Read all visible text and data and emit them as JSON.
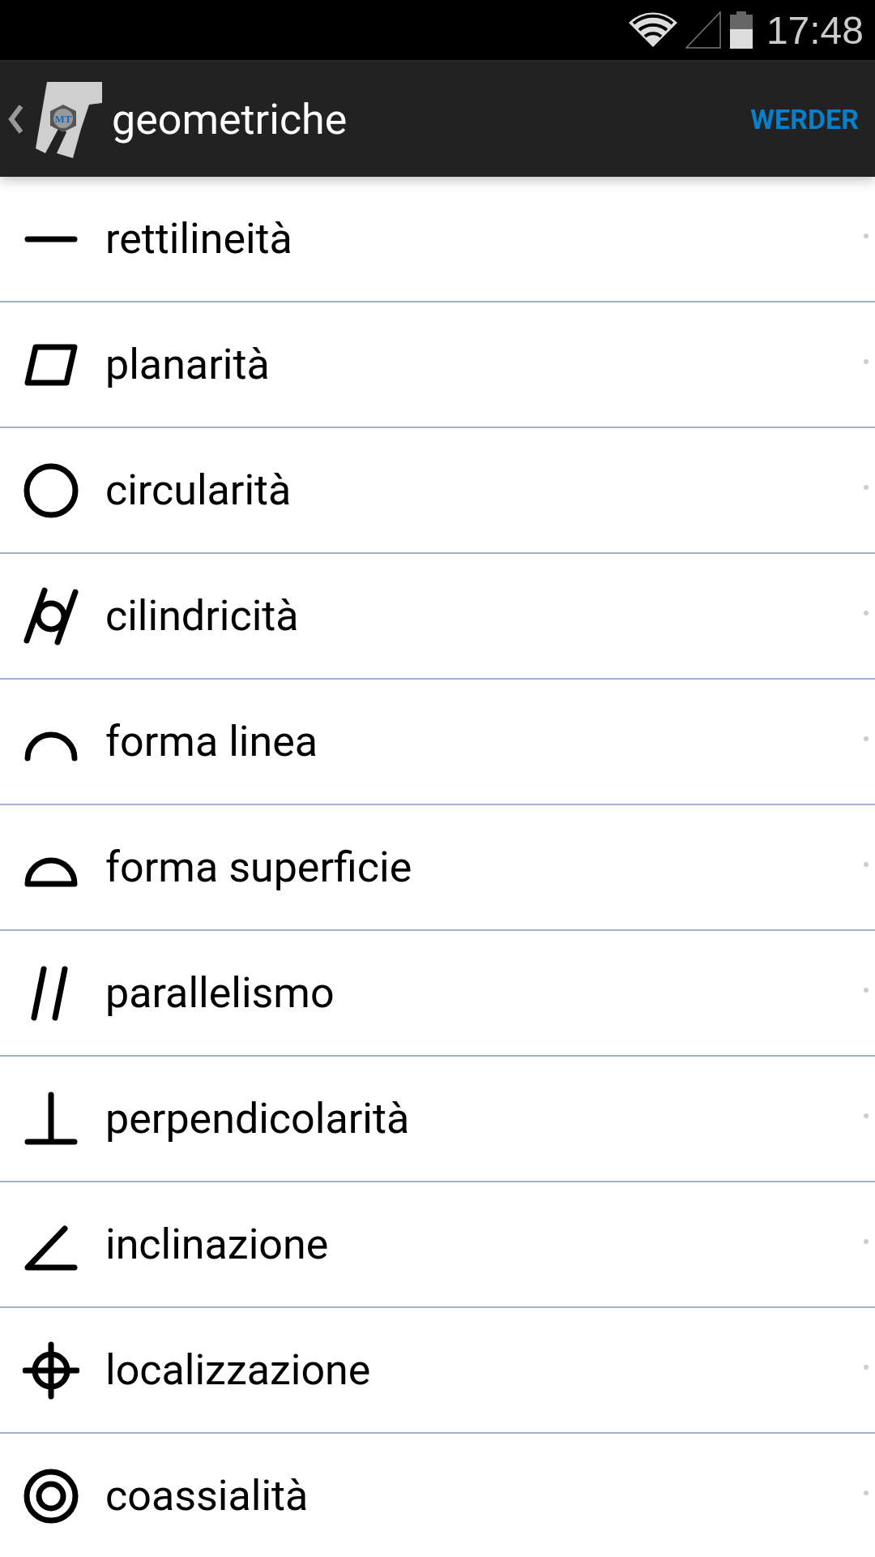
{
  "status_bar": {
    "time": "17:48"
  },
  "app_bar": {
    "logo_text": "MT",
    "title": "geometriche",
    "action": "WERDER"
  },
  "rows": [
    {
      "kind": "straightness",
      "label": "rettilineità"
    },
    {
      "kind": "flatness",
      "label": "planarità"
    },
    {
      "kind": "circularity",
      "label": "circularità"
    },
    {
      "kind": "cylindricity",
      "label": "cilindricità"
    },
    {
      "kind": "line_profile",
      "label": "forma linea"
    },
    {
      "kind": "surface_profile",
      "label": "forma superficie"
    },
    {
      "kind": "parallelism",
      "label": "parallelismo"
    },
    {
      "kind": "perpendicularity",
      "label": "perpendicolarità"
    },
    {
      "kind": "angularity",
      "label": "inclinazione"
    },
    {
      "kind": "position",
      "label": "localizzazione"
    },
    {
      "kind": "concentricity",
      "label": "coassialità"
    }
  ]
}
